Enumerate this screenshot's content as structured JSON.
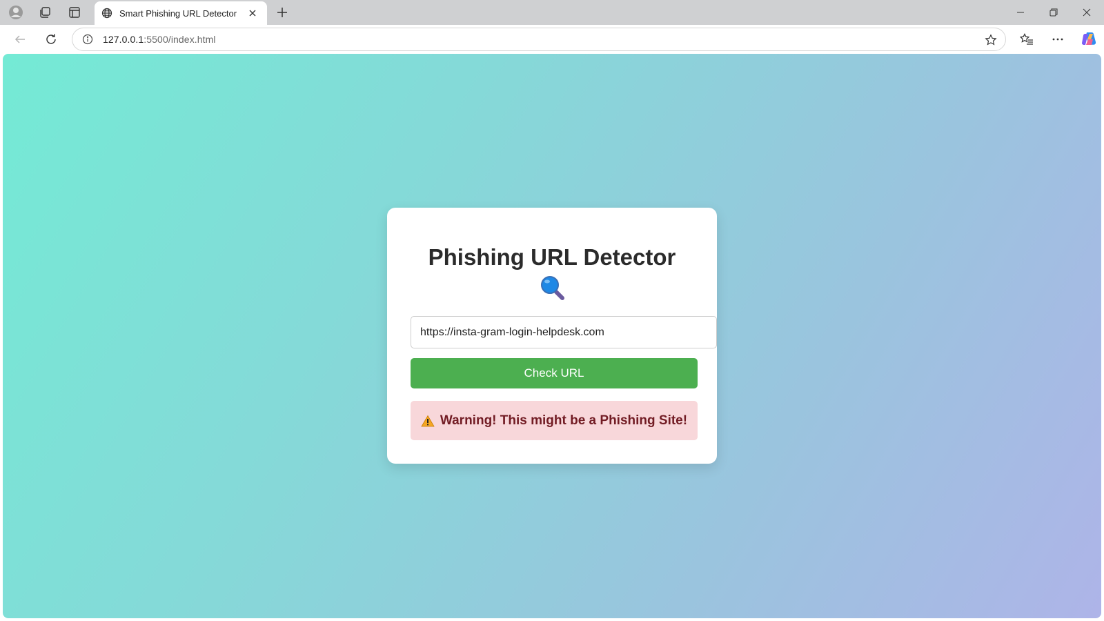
{
  "browser": {
    "tab_title": "Smart Phishing URL Detector",
    "url_host": "127.0.0.1",
    "url_path": ":5500/index.html"
  },
  "page": {
    "title": "Phishing URL Detector",
    "title_icon": "magnifying-glass-icon",
    "url_input_value": "https://insta-gram-login-helpdesk.com",
    "check_button_label": "Check URL",
    "result_icon": "warning-icon",
    "result_text": "Warning! This might be a Phishing Site!"
  },
  "colors": {
    "button": "#4caf50",
    "alert_bg": "#f8d7da",
    "alert_text": "#721c24",
    "gradient_start": "#74ead5",
    "gradient_end": "#aeb4e8"
  }
}
